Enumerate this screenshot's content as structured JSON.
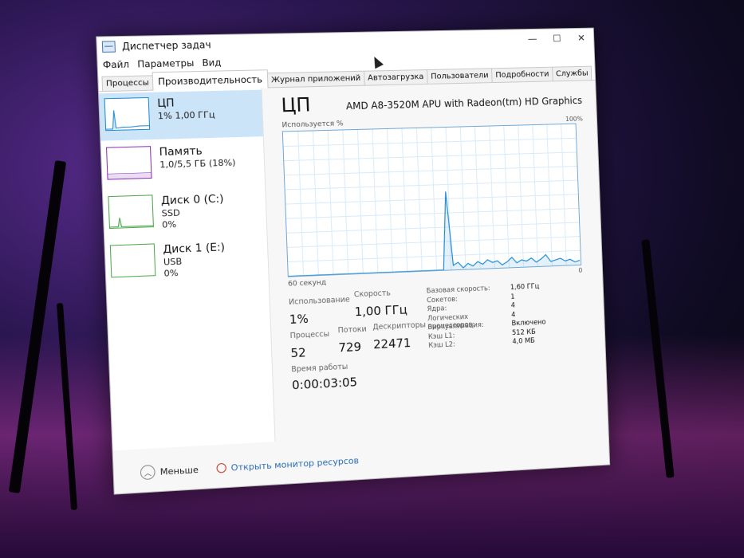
{
  "window": {
    "title": "Диспетчер задач",
    "controls": [
      "—",
      "☐",
      "✕"
    ]
  },
  "menu": [
    "Файл",
    "Параметры",
    "Вид"
  ],
  "tabs": [
    "Процессы",
    "Производительность",
    "Журнал приложений",
    "Автозагрузка",
    "Пользователи",
    "Подробности",
    "Службы"
  ],
  "sidebar": {
    "items": [
      {
        "title": "ЦП",
        "line1": "1% 1,00 ГГц",
        "line2": "",
        "color": "#1e8bd2"
      },
      {
        "title": "Память",
        "line1": "1,0/5,5 ГБ (18%)",
        "line2": "",
        "color": "#8a2fb5"
      },
      {
        "title": "Диск 0 (C:)",
        "line1": "SSD",
        "line2": "0%",
        "color": "#4aa84a"
      },
      {
        "title": "Диск 1 (E:)",
        "line1": "USB",
        "line2": "0%",
        "color": "#4aa84a"
      }
    ]
  },
  "main": {
    "title": "ЦП",
    "model": "AMD A8-3520M APU with Radeon(tm) HD Graphics",
    "graph_label_top": "Используется %",
    "graph_max": "100%",
    "graph_label_bottom": "60 секунд",
    "graph_min": "0",
    "stats": {
      "usage_label": "Использование",
      "usage_value": "1%",
      "speed_label": "Скорость",
      "speed_value": "1,00 ГГц",
      "processes_label": "Процессы",
      "processes_value": "52",
      "threads_label": "Потоки",
      "threads_value": "729",
      "handles_label": "Дескрипторы",
      "handles_value": "22471",
      "uptime_label": "Время работы",
      "uptime_value": "0:00:03:05"
    },
    "specs": [
      {
        "k": "Базовая скорость:",
        "v": "1,60 ГГц"
      },
      {
        "k": "Сокетов:",
        "v": "1"
      },
      {
        "k": "Ядра:",
        "v": "4"
      },
      {
        "k": "Логических процессоров:",
        "v": "4"
      },
      {
        "k": "Виртуализация:",
        "v": "Включено"
      },
      {
        "k": "Кэш L1:",
        "v": "512 КБ"
      },
      {
        "k": "Кэш L2:",
        "v": "4,0 МБ"
      }
    ]
  },
  "footer": {
    "less": "Меньше",
    "monitor_link": "Открыть монитор ресурсов"
  },
  "chart_data": {
    "type": "line",
    "ylim": [
      0,
      100
    ],
    "x_span": "60 секунд",
    "values": [
      0,
      0,
      0,
      0,
      0,
      0,
      0,
      0,
      0,
      0,
      0,
      0,
      0,
      0,
      0,
      0,
      0,
      0,
      0,
      0,
      0,
      0,
      0,
      0,
      0,
      0,
      0,
      0,
      0,
      0,
      0,
      0,
      55,
      3,
      5,
      1,
      4,
      2,
      5,
      3,
      6,
      4,
      5,
      2,
      4,
      7,
      3,
      5,
      4,
      6,
      3,
      5,
      8,
      3,
      4,
      5,
      3,
      4,
      2,
      3
    ]
  }
}
